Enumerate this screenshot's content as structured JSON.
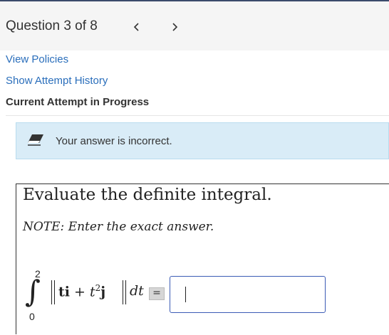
{
  "header": {
    "title": "Question 3 of 8",
    "prev_icon": "chevron-left-icon",
    "next_icon": "chevron-right-icon"
  },
  "links": {
    "view_policies": "View Policies",
    "show_attempt_history": "Show Attempt History"
  },
  "attempt_status": "Current Attempt in Progress",
  "alert": {
    "icon": "eraser-icon",
    "text": "Your answer is incorrect."
  },
  "question": {
    "prompt": "Evaluate the definite integral.",
    "note": "NOTE:  Enter the exact answer.",
    "integral": {
      "upper": "2",
      "lower": "0",
      "integrand_t1": "t",
      "integrand_i": "i",
      "plus": " + ",
      "integrand_t2": "t",
      "exponent": "2",
      "integrand_j": "j",
      "differential": "dt"
    },
    "equals": "=",
    "answer_value": ""
  },
  "colors": {
    "link": "#2a6ebb",
    "alert_bg": "#d9ecf7",
    "input_border": "#3b5bb5",
    "header_bg": "#f5f5f5"
  }
}
